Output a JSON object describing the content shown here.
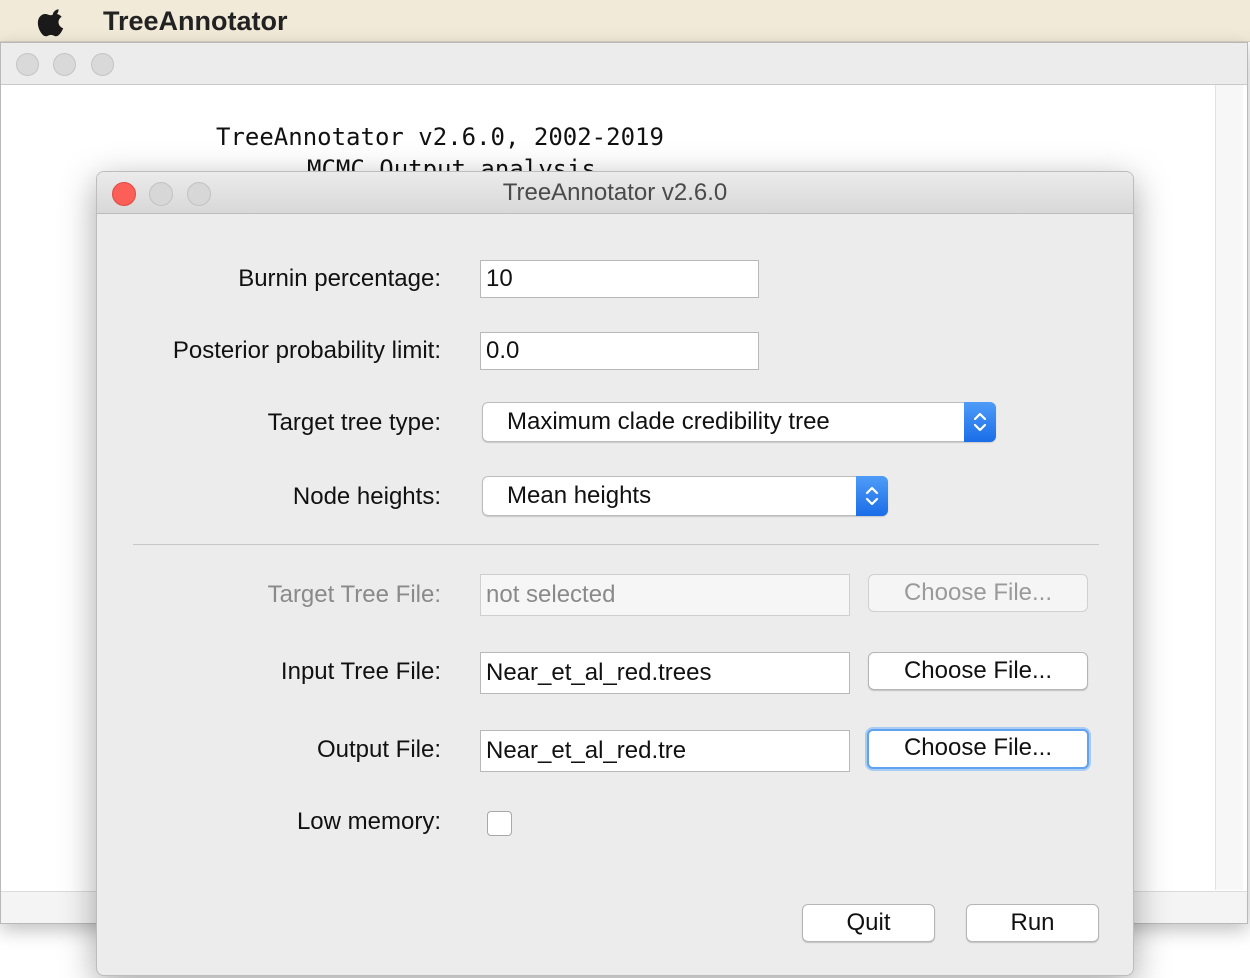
{
  "menubar": {
    "app_name": "TreeAnnotator"
  },
  "console": {
    "lines": [
      "TreeAnnotator v2.6.0, 2002-2019",
      "MCMC Output analysis"
    ]
  },
  "dialog": {
    "title": "TreeAnnotator v2.6.0",
    "burnin": {
      "label": "Burnin percentage:",
      "value": "10"
    },
    "posterior": {
      "label": "Posterior probability limit:",
      "value": "0.0"
    },
    "target_tree_type": {
      "label": "Target tree type:",
      "selected": "Maximum clade credibility tree"
    },
    "node_heights": {
      "label": "Node heights:",
      "selected": "Mean heights"
    },
    "target_tree_file": {
      "label": "Target Tree File:",
      "value": "not selected",
      "button": "Choose File..."
    },
    "input_tree_file": {
      "label": "Input Tree File:",
      "value": "Near_et_al_red.trees",
      "button": "Choose File..."
    },
    "output_file": {
      "label": "Output File:",
      "value": "Near_et_al_red.tre",
      "button": "Choose File..."
    },
    "low_memory": {
      "label": "Low memory:",
      "checked": false
    },
    "quit_label": "Quit",
    "run_label": "Run"
  },
  "colors": {
    "close_button": "#fc5f57",
    "popup_accent": "#1a6de8",
    "focus_ring": "#5fa2ef"
  }
}
